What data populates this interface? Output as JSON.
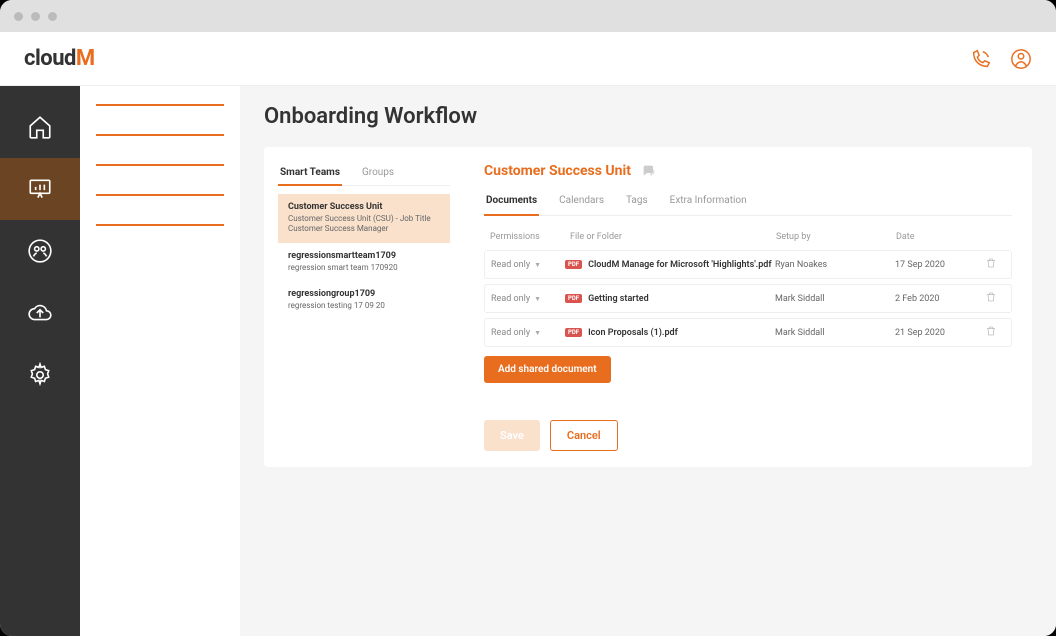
{
  "logo": {
    "prefix": "cloud",
    "suffix": "M"
  },
  "page_title": "Onboarding Workflow",
  "team_tabs": [
    {
      "label": "Smart Teams",
      "active": true
    },
    {
      "label": "Groups",
      "active": false
    }
  ],
  "teams": [
    {
      "name": "Customer Success Unit",
      "desc": "Customer Success Unit (CSU) - Job Title Customer Success Manager",
      "selected": true
    },
    {
      "name": "regressionsmartteam1709",
      "desc": "regression smart team 170920",
      "selected": false
    },
    {
      "name": "regressiongroup1709",
      "desc": "regression testing 17 09 20",
      "selected": false
    }
  ],
  "detail": {
    "title": "Customer Success Unit",
    "subtabs": [
      {
        "label": "Documents",
        "active": true
      },
      {
        "label": "Calendars",
        "active": false
      },
      {
        "label": "Tags",
        "active": false
      },
      {
        "label": "Extra Information",
        "active": false
      }
    ],
    "columns": {
      "perm": "Permissions",
      "file": "File or Folder",
      "setup": "Setup by",
      "date": "Date"
    },
    "rows": [
      {
        "perm": "Read only",
        "badge": "PDF",
        "file": "CloudM Manage for Microsoft 'Highlights'.pdf",
        "setup": "Ryan Noakes",
        "date": "17 Sep 2020"
      },
      {
        "perm": "Read only",
        "badge": "PDF",
        "file": "Getting started",
        "setup": "Mark Siddall",
        "date": "2 Feb 2020"
      },
      {
        "perm": "Read only",
        "badge": "PDF",
        "file": "Icon Proposals (1).pdf",
        "setup": "Mark Siddall",
        "date": "21 Sep 2020"
      }
    ],
    "add_label": "Add shared document",
    "save": "Save",
    "cancel": "Cancel"
  }
}
